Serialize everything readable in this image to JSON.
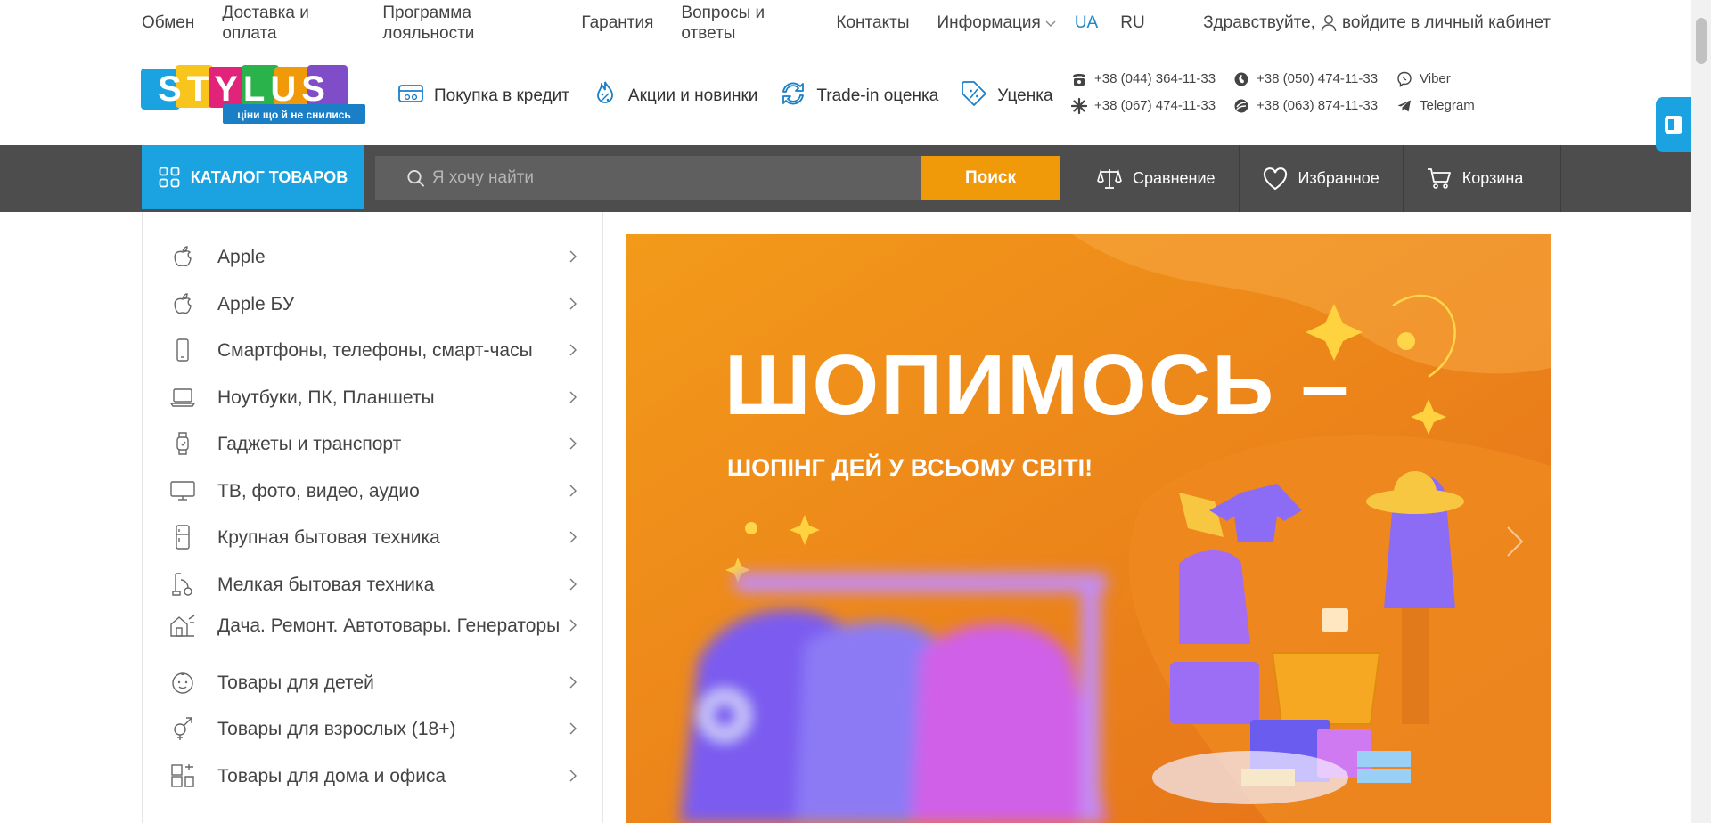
{
  "topnav": {
    "items": [
      "Обмен",
      "Доставка и оплата",
      "Программа лояльности",
      "Гарантия",
      "Вопросы и ответы",
      "Контакты",
      "Информация"
    ],
    "lang_ua": "UA",
    "lang_ru": "RU",
    "greeting": "Здравствуйте,",
    "login_label": "войдите в личный кабинет"
  },
  "logo": {
    "text": "STYLUS",
    "tagline": "ціни що й не снились",
    "colors": [
      "#1aa3e0",
      "#f7c51b",
      "#e2237a",
      "#29b34a",
      "#f09a0a",
      "#7f4dc8"
    ]
  },
  "features": [
    {
      "icon": "credit-card-icon",
      "label": "Покупка в кредит"
    },
    {
      "icon": "percent-fire-icon",
      "label": "Акции и новинки"
    },
    {
      "icon": "exchange-icon",
      "label": "Trade-in оценка"
    },
    {
      "icon": "discount-tag-icon",
      "label": "Уценка"
    }
  ],
  "phones": [
    {
      "icon": "phone-icon",
      "label": "+38 (044) 364-11-33"
    },
    {
      "icon": "vodafone-icon",
      "label": "+38 (050) 474-11-33"
    },
    {
      "icon": "viber-icon",
      "label": "Viber"
    },
    {
      "icon": "kyivstar-icon",
      "label": "+38 (067) 474-11-33"
    },
    {
      "icon": "lifecell-icon",
      "label": "+38 (063) 874-11-33"
    },
    {
      "icon": "telegram-icon",
      "label": "Telegram"
    }
  ],
  "navbar": {
    "catalog_label": "КАТАЛОГ ТОВАРОВ",
    "search_placeholder": "Я хочу найти",
    "search_button": "Поиск",
    "compare": "Сравнение",
    "favorites": "Избранное",
    "cart": "Корзина"
  },
  "categories": [
    {
      "icon": "apple-icon",
      "label": "Apple"
    },
    {
      "icon": "apple-icon",
      "label": "Apple БУ"
    },
    {
      "icon": "smartphone-icon",
      "label": "Смартфоны, телефоны, смарт-часы"
    },
    {
      "icon": "laptop-icon",
      "label": "Ноутбуки, ПК, Планшеты"
    },
    {
      "icon": "smartwatch-icon",
      "label": "Гаджеты и транспорт"
    },
    {
      "icon": "tv-icon",
      "label": "ТВ, фото, видео, аудио"
    },
    {
      "icon": "fridge-icon",
      "label": "Крупная бытовая техника"
    },
    {
      "icon": "vacuum-icon",
      "label": "Мелкая бытовая техника"
    },
    {
      "icon": "house-tools-icon",
      "label": "Дача. Ремонт. Автотовары. Генераторы"
    },
    {
      "icon": "baby-icon",
      "label": "Товары для детей"
    },
    {
      "icon": "gender-icon",
      "label": "Товары для взрослых (18+)"
    },
    {
      "icon": "home-office-icon",
      "label": "Товары для дома и офиса"
    }
  ],
  "banner": {
    "title": "ШОПИМОСЬ –",
    "subtitle": "ШОПІНГ ДЕЙ У ВСЬОМУ СВІТІ!",
    "bg_start": "#f39a1a",
    "bg_end": "#e56a1a"
  }
}
